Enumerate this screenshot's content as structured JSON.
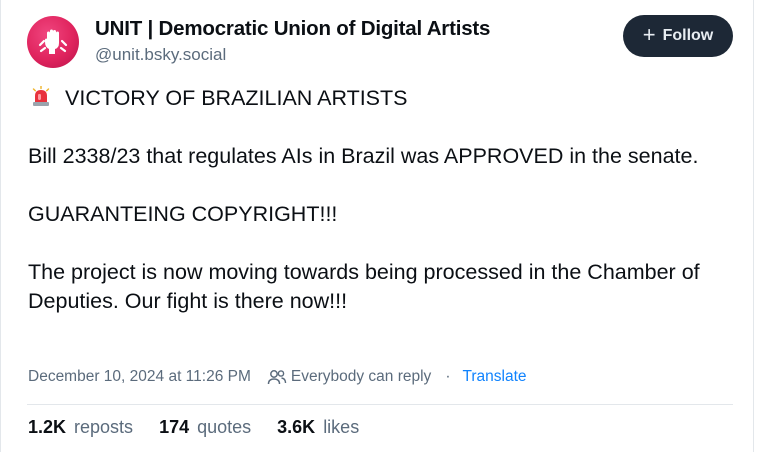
{
  "author": {
    "display_name": "UNIT | Democratic Union of Digital Artists",
    "handle": "@unit.bsky.social",
    "avatar_icon": "raised-fist-logo-icon",
    "avatar_color": "#e0245e"
  },
  "follow_button": {
    "label": "Follow",
    "icon": "plus-icon"
  },
  "post": {
    "headline_icon": "police-light-emoji-icon",
    "headline": "VICTORY OF BRAZILIAN ARTISTS",
    "paragraph_1": "Bill 2338/23 that regulates AIs in Brazil was APPROVED in the senate.",
    "paragraph_2": "GUARANTEING COPYRIGHT!!!",
    "paragraph_3": "The project is now moving towards being processed in the Chamber of Deputies. Our fight is there now!!!"
  },
  "meta": {
    "timestamp": "December 10, 2024 at 11:26 PM",
    "reply_icon": "people-icon",
    "reply_setting": "Everybody can reply",
    "separator": "·",
    "translate": "Translate"
  },
  "stats": {
    "reposts_count": "1.2K",
    "reposts_label": "reposts",
    "quotes_count": "174",
    "quotes_label": "quotes",
    "likes_count": "3.6K",
    "likes_label": "likes"
  },
  "colors": {
    "accent": "#1083fe",
    "muted": "#5b6b7c",
    "button_bg": "#1d2836"
  }
}
